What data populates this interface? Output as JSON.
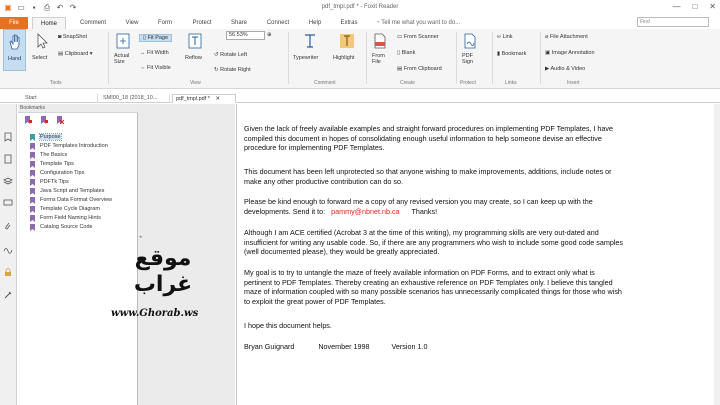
{
  "window": {
    "title": "pdf_tmpl.pdf * - Foxit Reader",
    "controls": [
      "—",
      "□",
      "✕"
    ]
  },
  "ribbon_tabs": {
    "file": "File",
    "items": [
      "Home",
      "Comment",
      "View",
      "Form",
      "Protect",
      "Share",
      "Connect",
      "Help",
      "Extras"
    ],
    "active": "Home",
    "tell_me": "Tell me what you want to do...",
    "find_placeholder": "Find"
  },
  "ribbon": {
    "tools": {
      "hand": "Hand",
      "select": "Select",
      "snapshot": "SnapShot",
      "clipboard": "Clipboard",
      "label": "Tools"
    },
    "view": {
      "actual_size": "Actual Size",
      "fit_page": "Fit Page",
      "fit_width": "Fit Width",
      "fit_visible": "Fit Visible",
      "reflow": "Reflow",
      "zoom": "56.53%",
      "rotate_left": "Rotate Left",
      "rotate_right": "Rotate Right",
      "label": "View"
    },
    "comment": {
      "typewriter": "Typewriter",
      "highlight": "Highlight",
      "label": "Comment"
    },
    "create": {
      "from_file": "From File",
      "from_scanner": "From Scanner",
      "blank": "Blank",
      "from_clipboard": "From Clipboard",
      "label": "Create"
    },
    "protect": {
      "pdf_sign": "PDF Sign",
      "label": "Protect"
    },
    "links": {
      "link": "Link",
      "bookmark": "Bookmark",
      "label": "Links"
    },
    "insert": {
      "file_attachment": "File Attachment",
      "image_annotation": "Image Annotation",
      "audio_video": "Audio & Video",
      "label": "Insert"
    }
  },
  "doc_tabs": [
    "Start",
    "SMI00_18 (2018_10...",
    "pdf_tmpl.pdf *"
  ],
  "bookmarks": {
    "header": "Bookmarks",
    "items": [
      "Purpose",
      "PDF Templates Introduction",
      "The Basics",
      "Template Tips",
      "Configuration Tips",
      "PDFTk Tips",
      "Java Script and Templates",
      "Forms Data Format Overview",
      "Template Cycle Diagram",
      "Form Field Naming Hints",
      "Catalog Source Code"
    ],
    "selected": 0
  },
  "document": {
    "p1": "Given the lack of freely available examples and straight forward procedures on implementing PDF Templates, I have compiled this document in hopes of consolidating enough useful information to help someone devise an effective procedure for implementing PDF Templates.",
    "p2": "This document has been left unprotected so that anyone wishing to make improvements, additions, include notes or make any other productive contribution can do so.",
    "p3a": "Please be kind enough to forward me a copy of any revised version you may create, so I can keep up with the developments. Send it to:",
    "p3_email": "pammy@nbnet.nb.ca",
    "p3b": "Thanks!",
    "p4": "Although I am ACE certified (Acrobat 3 at the time of this writing), my programming skills are very out-dated and insufficient for writing any usable code. So, if there are any programmers who wish to include some good code samples (well documented please), they would be greatly appreciated.",
    "p5": "My goal is to try to untangle the maze of freely available information on PDF Forms, and to extract only what is pertinent to PDF Templates. Thereby creating an exhaustive reference on PDF Templates only. I believe this tangled maze of information coupled with so many possible scenarios has unnecessarily complicated things for those who wish to exploit the great power of PDF Templates.",
    "p6": "I hope this document helps.",
    "sig_name": "Bryan Guignard",
    "sig_date": "November 1998",
    "sig_version": "Version 1.0"
  },
  "watermark": {
    "arabic": "موقع غراب",
    "url": "www.Ghorab.ws"
  },
  "colors": {
    "accent": "#e37222",
    "ribbon_bg": "#f5f5f5",
    "selected_bg": "#cfe2f3",
    "email": "#e2231a",
    "bookmark_flag": "#8e6bb0"
  }
}
